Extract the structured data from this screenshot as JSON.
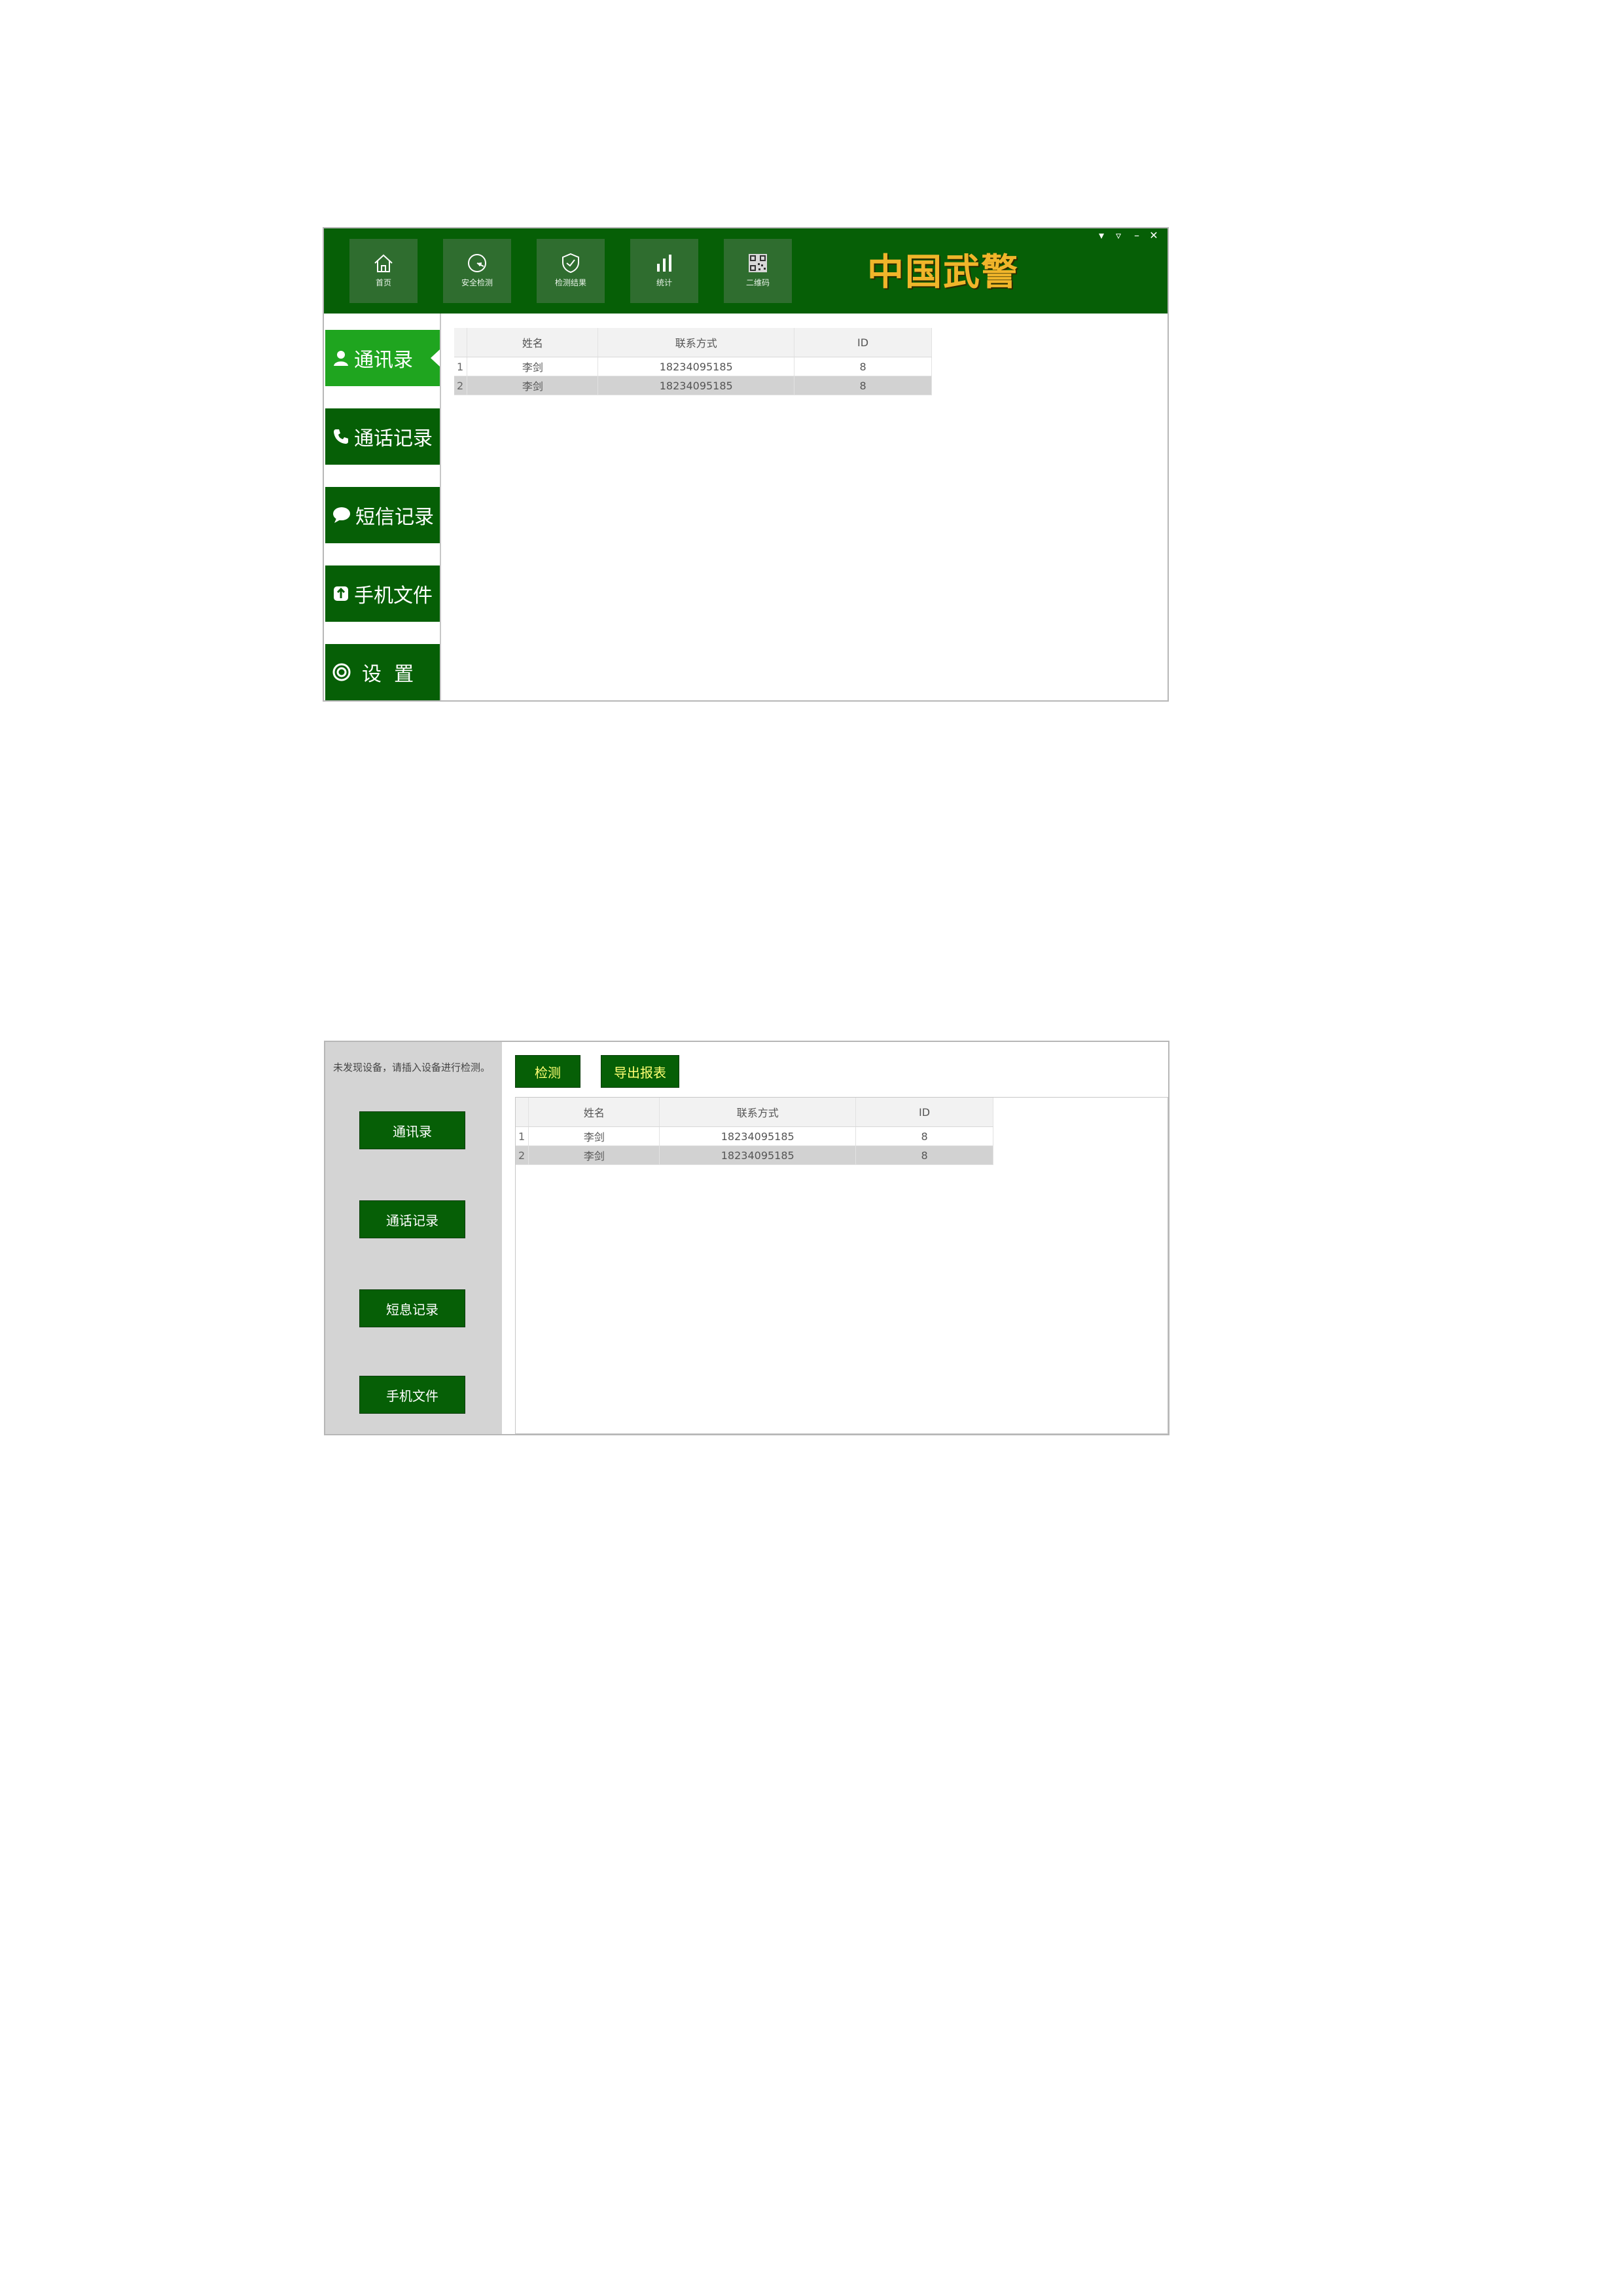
{
  "window1": {
    "toolbar": [
      {
        "label": "首页",
        "icon": "home-icon"
      },
      {
        "label": "安全检测",
        "icon": "scan-icon"
      },
      {
        "label": "检测结果",
        "icon": "shield-icon"
      },
      {
        "label": "统计",
        "icon": "bar-chart-icon"
      },
      {
        "label": "二维码",
        "icon": "qr-code-icon"
      }
    ],
    "brand": "中国武警",
    "window_controls": [
      "▾",
      "▿",
      "–",
      "✕"
    ],
    "nav": [
      {
        "label": "通讯录",
        "icon": "person-icon",
        "active": true
      },
      {
        "label": "通话记录",
        "icon": "phone-icon",
        "active": false
      },
      {
        "label": "短信记录",
        "icon": "chat-icon",
        "active": false
      },
      {
        "label": "手机文件",
        "icon": "file-icon",
        "active": false
      },
      {
        "label": "设  置",
        "icon": "gear-icon",
        "active": false
      }
    ],
    "table": {
      "columns": [
        "姓名",
        "联系方式",
        "ID"
      ],
      "rows": [
        {
          "num": "1",
          "name": "李剑",
          "phone": "18234095185",
          "id": "8"
        },
        {
          "num": "2",
          "name": "李剑",
          "phone": "18234095185",
          "id": "8"
        }
      ]
    }
  },
  "window2": {
    "notice": "未发现设备，请插入设备进行检测。",
    "left_buttons": [
      "通讯录",
      "通话记录",
      "短息记录",
      "手机文件"
    ],
    "top_buttons": [
      "检测",
      "导出报表"
    ],
    "table": {
      "columns": [
        "姓名",
        "联系方式",
        "ID"
      ],
      "rows": [
        {
          "num": "1",
          "name": "李剑",
          "phone": "18234095185",
          "id": "8"
        },
        {
          "num": "2",
          "name": "李剑",
          "phone": "18234095185",
          "id": "8"
        }
      ]
    }
  },
  "colors": {
    "primary_green": "#065f06",
    "active_green": "#1fa51f",
    "brand_gold": "#f0b52a",
    "panel_gray": "#d4d4d4",
    "selected_row": "#d2d2d2"
  }
}
